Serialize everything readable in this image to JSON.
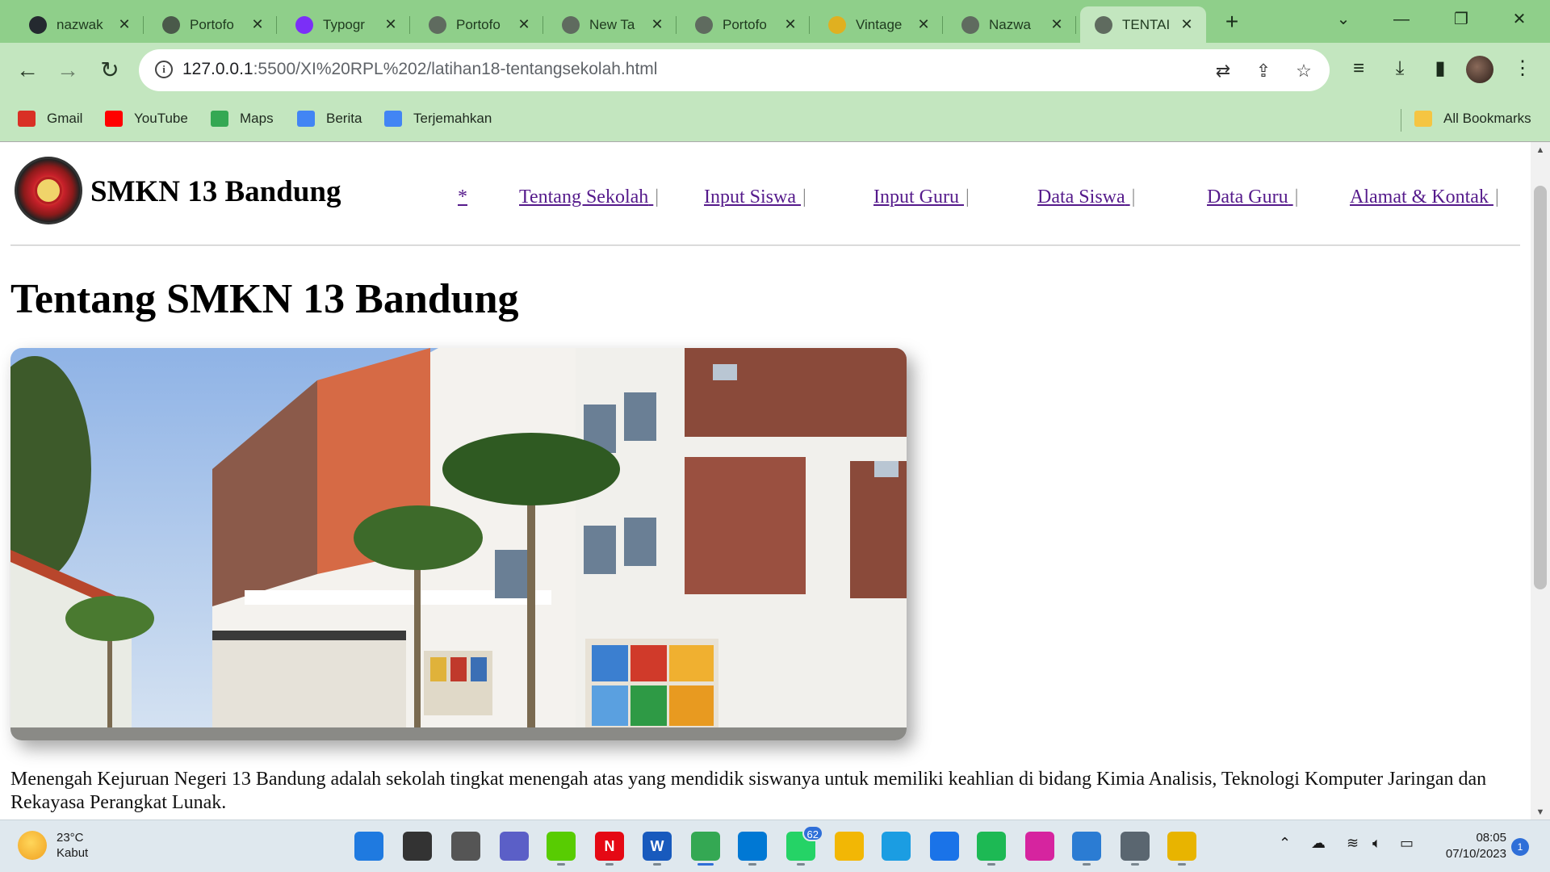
{
  "browser": {
    "tabs": [
      {
        "title": "nazwak",
        "icon": "github-icon",
        "color": "#24292f"
      },
      {
        "title": "Portofo",
        "icon": "chatgpt-icon",
        "color": "#4a5a4a"
      },
      {
        "title": "Typogr",
        "icon": "bootstrap-icon",
        "color": "#7b2ff7"
      },
      {
        "title": "Portofo",
        "icon": "globe-icon",
        "color": "#5f6b5f"
      },
      {
        "title": "New Ta",
        "icon": "globe-icon",
        "color": "#5f6b5f"
      },
      {
        "title": "Portofo",
        "icon": "globe-icon",
        "color": "#5f6b5f"
      },
      {
        "title": "Vintage",
        "icon": "vintage-icon",
        "color": "#e0b020"
      },
      {
        "title": "Nazwa",
        "icon": "globe-icon",
        "color": "#5f6b5f"
      },
      {
        "title": "TENTAI",
        "icon": "globe-icon",
        "color": "#5f6b5f",
        "active": true
      }
    ],
    "address": {
      "host": "127.0.0.1",
      "path": ":5500/XI%20RPL%202/latihan18-tentangsekolah.html"
    },
    "bookmarks": [
      {
        "label": "Gmail",
        "icon": "gmail-icon",
        "color": "#d93025"
      },
      {
        "label": "YouTube",
        "icon": "youtube-icon",
        "color": "#ff0000"
      },
      {
        "label": "Maps",
        "icon": "maps-icon",
        "color": "#34a853"
      },
      {
        "label": "Berita",
        "icon": "news-icon",
        "color": "#4285f4"
      },
      {
        "label": "Terjemahkan",
        "icon": "translate-icon",
        "color": "#4285f4"
      }
    ],
    "all_bookmarks": "All Bookmarks"
  },
  "site": {
    "name": "SMKN 13 Bandung",
    "nav": [
      {
        "label": "*"
      },
      {
        "label": "Tentang Sekolah"
      },
      {
        "label": "Input Siswa"
      },
      {
        "label": "Input Guru"
      },
      {
        "label": "Data Siswa"
      },
      {
        "label": "Data Guru"
      },
      {
        "label": "Alamat & Kontak"
      }
    ],
    "pipe": "|",
    "heading": "Tentang SMKN 13 Bandung",
    "paragraph": "Menengah Kejuruan Negeri 13 Bandung adalah sekolah tingkat menengah atas yang mendidik siswanya untuk memiliki keahlian di bidang Kimia Analisis, Teknologi Komputer Jaringan dan Rekayasa Perangkat Lunak."
  },
  "taskbar": {
    "weather": {
      "temp": "23°C",
      "condition": "Kabut"
    },
    "apps": [
      {
        "name": "windows-start-icon",
        "color": "#1f7ae0"
      },
      {
        "name": "search-icon",
        "color": "#333333"
      },
      {
        "name": "task-view-icon",
        "color": "#555555"
      },
      {
        "name": "meet-icon",
        "color": "#5b5fc7"
      },
      {
        "name": "duolingo-icon",
        "color": "#58cc02"
      },
      {
        "name": "netflix-icon",
        "color": "#e50914",
        "glyph": "N"
      },
      {
        "name": "word-icon",
        "color": "#185abd",
        "glyph": "W"
      },
      {
        "name": "chrome-icon",
        "color": "#34a853"
      },
      {
        "name": "vscode-icon",
        "color": "#0078d4"
      },
      {
        "name": "whatsapp-icon",
        "color": "#25d366",
        "badge": "62"
      },
      {
        "name": "file-explorer-icon",
        "color": "#f2b705"
      },
      {
        "name": "edge-icon",
        "color": "#1b9de2"
      },
      {
        "name": "store-icon",
        "color": "#1a73e8"
      },
      {
        "name": "spotify-icon",
        "color": "#1db954"
      },
      {
        "name": "instagram-icon",
        "color": "#d6249f"
      },
      {
        "name": "paint-icon",
        "color": "#2b7cd3"
      },
      {
        "name": "settings-icon",
        "color": "#5a6670"
      },
      {
        "name": "sticky-app-icon",
        "color": "#e8b400"
      }
    ],
    "clock": {
      "time": "08:05",
      "date": "07/10/2023"
    },
    "notifications": "1"
  }
}
